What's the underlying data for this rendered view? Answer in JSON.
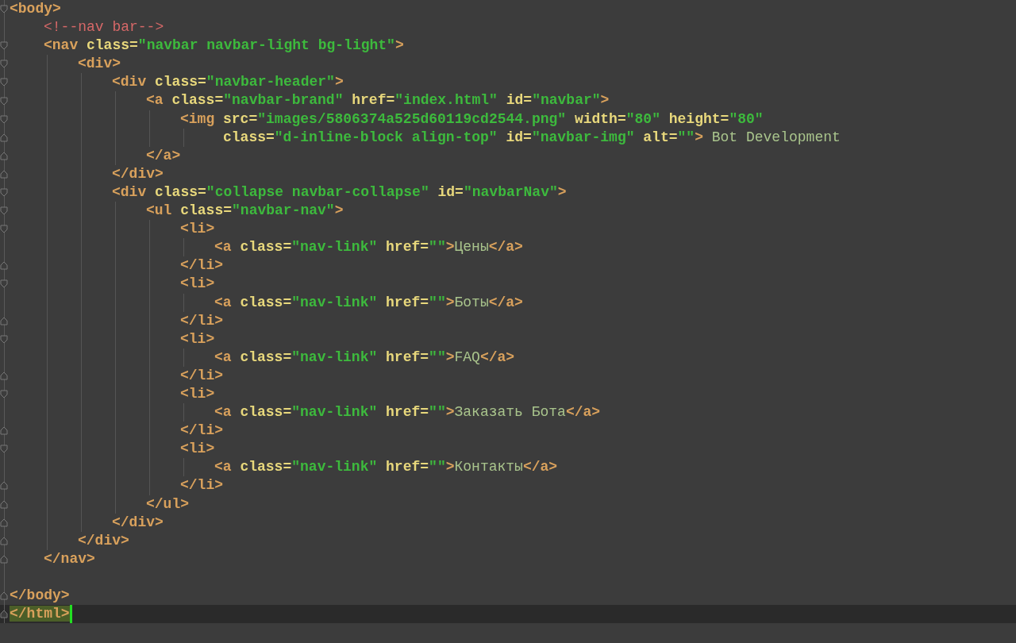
{
  "editor": {
    "lines": [
      {
        "fold_start": true,
        "tokens": [
          {
            "kind": "tag",
            "text": "<body>"
          }
        ],
        "children": [
          {
            "tokens": [
              {
                "kind": "comment",
                "text": "<!--nav bar-->"
              }
            ]
          },
          {
            "fold_start": true,
            "tokens": [
              {
                "kind": "tag",
                "text": "<nav"
              },
              {
                "kind": "attr",
                "text": " class="
              },
              {
                "kind": "str",
                "text": "\"navbar navbar-light bg-light\""
              },
              {
                "kind": "tag",
                "text": ">"
              }
            ],
            "children": [
              {
                "fold_start": true,
                "tokens": [
                  {
                    "kind": "tag",
                    "text": "<div>"
                  }
                ],
                "children": [
                  {
                    "fold_start": true,
                    "tokens": [
                      {
                        "kind": "tag",
                        "text": "<div"
                      },
                      {
                        "kind": "attr",
                        "text": " class="
                      },
                      {
                        "kind": "str",
                        "text": "\"navbar-header\""
                      },
                      {
                        "kind": "tag",
                        "text": ">"
                      }
                    ],
                    "children": [
                      {
                        "fold_start": true,
                        "tokens": [
                          {
                            "kind": "tag",
                            "text": "<a"
                          },
                          {
                            "kind": "attr",
                            "text": " class="
                          },
                          {
                            "kind": "str",
                            "text": "\"navbar-brand\""
                          },
                          {
                            "kind": "attr",
                            "text": " href="
                          },
                          {
                            "kind": "str",
                            "text": "\"index.html\""
                          },
                          {
                            "kind": "attr",
                            "text": " id="
                          },
                          {
                            "kind": "str",
                            "text": "\"navbar\""
                          },
                          {
                            "kind": "tag",
                            "text": ">"
                          }
                        ],
                        "children": [
                          {
                            "fold_start": true,
                            "tokens": [
                              {
                                "kind": "tag",
                                "text": "<img"
                              },
                              {
                                "kind": "attr",
                                "text": " src="
                              },
                              {
                                "kind": "str",
                                "text": "\"images/5806374a525d60119cd2544.png\""
                              },
                              {
                                "kind": "attr",
                                "text": " width="
                              },
                              {
                                "kind": "str",
                                "text": "\"80\""
                              },
                              {
                                "kind": "attr",
                                "text": " height="
                              },
                              {
                                "kind": "str",
                                "text": "\"80\""
                              }
                            ],
                            "wrap": [
                              {
                                "fold_end": true,
                                "tokens": [
                                  {
                                    "kind": "attr",
                                    "text": "class="
                                  },
                                  {
                                    "kind": "str",
                                    "text": "\"d-inline-block align-top\""
                                  },
                                  {
                                    "kind": "attr",
                                    "text": " id="
                                  },
                                  {
                                    "kind": "str",
                                    "text": "\"navbar-img\""
                                  },
                                  {
                                    "kind": "attr",
                                    "text": " alt="
                                  },
                                  {
                                    "kind": "str",
                                    "text": "\"\""
                                  },
                                  {
                                    "kind": "tag",
                                    "text": ">"
                                  },
                                  {
                                    "kind": "text",
                                    "text": " Bot Development"
                                  }
                                ]
                              }
                            ]
                          }
                        ]
                      },
                      {
                        "fold_end": true,
                        "tokens": [
                          {
                            "kind": "tag",
                            "text": "</a>"
                          }
                        ]
                      }
                    ]
                  },
                  {
                    "fold_end": true,
                    "tokens": [
                      {
                        "kind": "tag",
                        "text": "</div>"
                      }
                    ]
                  },
                  {
                    "fold_start": true,
                    "tokens": [
                      {
                        "kind": "tag",
                        "text": "<div"
                      },
                      {
                        "kind": "attr",
                        "text": " class="
                      },
                      {
                        "kind": "str",
                        "text": "\"collapse navbar-collapse\""
                      },
                      {
                        "kind": "attr",
                        "text": " id="
                      },
                      {
                        "kind": "str",
                        "text": "\"navbarNav\""
                      },
                      {
                        "kind": "tag",
                        "text": ">"
                      }
                    ],
                    "children": [
                      {
                        "fold_start": true,
                        "tokens": [
                          {
                            "kind": "tag",
                            "text": "<ul"
                          },
                          {
                            "kind": "attr",
                            "text": " class="
                          },
                          {
                            "kind": "str",
                            "text": "\"navbar-nav\""
                          },
                          {
                            "kind": "tag",
                            "text": ">"
                          }
                        ],
                        "children": [
                          {
                            "fold_start": true,
                            "tokens": [
                              {
                                "kind": "tag",
                                "text": "<li>"
                              }
                            ],
                            "children": [
                              {
                                "tokens": [
                                  {
                                    "kind": "tag",
                                    "text": "<a"
                                  },
                                  {
                                    "kind": "attr",
                                    "text": " class="
                                  },
                                  {
                                    "kind": "str",
                                    "text": "\"nav-link\""
                                  },
                                  {
                                    "kind": "attr",
                                    "text": " href="
                                  },
                                  {
                                    "kind": "str",
                                    "text": "\"\""
                                  },
                                  {
                                    "kind": "tag",
                                    "text": ">"
                                  },
                                  {
                                    "kind": "text",
                                    "text": "Цены"
                                  },
                                  {
                                    "kind": "tag",
                                    "text": "</a>"
                                  }
                                ]
                              }
                            ]
                          },
                          {
                            "fold_end": true,
                            "tokens": [
                              {
                                "kind": "tag",
                                "text": "</li>"
                              }
                            ]
                          },
                          {
                            "fold_start": true,
                            "tokens": [
                              {
                                "kind": "tag",
                                "text": "<li>"
                              }
                            ],
                            "children": [
                              {
                                "tokens": [
                                  {
                                    "kind": "tag",
                                    "text": "<a"
                                  },
                                  {
                                    "kind": "attr",
                                    "text": " class="
                                  },
                                  {
                                    "kind": "str",
                                    "text": "\"nav-link\""
                                  },
                                  {
                                    "kind": "attr",
                                    "text": " href="
                                  },
                                  {
                                    "kind": "str",
                                    "text": "\"\""
                                  },
                                  {
                                    "kind": "tag",
                                    "text": ">"
                                  },
                                  {
                                    "kind": "text",
                                    "text": "Боты"
                                  },
                                  {
                                    "kind": "tag",
                                    "text": "</a>"
                                  }
                                ]
                              }
                            ]
                          },
                          {
                            "fold_end": true,
                            "tokens": [
                              {
                                "kind": "tag",
                                "text": "</li>"
                              }
                            ]
                          },
                          {
                            "fold_start": true,
                            "tokens": [
                              {
                                "kind": "tag",
                                "text": "<li>"
                              }
                            ],
                            "children": [
                              {
                                "tokens": [
                                  {
                                    "kind": "tag",
                                    "text": "<a"
                                  },
                                  {
                                    "kind": "attr",
                                    "text": " class="
                                  },
                                  {
                                    "kind": "str",
                                    "text": "\"nav-link\""
                                  },
                                  {
                                    "kind": "attr",
                                    "text": " href="
                                  },
                                  {
                                    "kind": "str",
                                    "text": "\"\""
                                  },
                                  {
                                    "kind": "tag",
                                    "text": ">"
                                  },
                                  {
                                    "kind": "text",
                                    "text": "FAQ"
                                  },
                                  {
                                    "kind": "tag",
                                    "text": "</a>"
                                  }
                                ]
                              }
                            ]
                          },
                          {
                            "fold_end": true,
                            "tokens": [
                              {
                                "kind": "tag",
                                "text": "</li>"
                              }
                            ]
                          },
                          {
                            "fold_start": true,
                            "tokens": [
                              {
                                "kind": "tag",
                                "text": "<li>"
                              }
                            ],
                            "children": [
                              {
                                "tokens": [
                                  {
                                    "kind": "tag",
                                    "text": "<a"
                                  },
                                  {
                                    "kind": "attr",
                                    "text": " class="
                                  },
                                  {
                                    "kind": "str",
                                    "text": "\"nav-link\""
                                  },
                                  {
                                    "kind": "attr",
                                    "text": " href="
                                  },
                                  {
                                    "kind": "str",
                                    "text": "\"\""
                                  },
                                  {
                                    "kind": "tag",
                                    "text": ">"
                                  },
                                  {
                                    "kind": "text",
                                    "text": "Заказать Бота"
                                  },
                                  {
                                    "kind": "tag",
                                    "text": "</a>"
                                  }
                                ]
                              }
                            ]
                          },
                          {
                            "fold_end": true,
                            "tokens": [
                              {
                                "kind": "tag",
                                "text": "</li>"
                              }
                            ]
                          },
                          {
                            "fold_start": true,
                            "tokens": [
                              {
                                "kind": "tag",
                                "text": "<li>"
                              }
                            ],
                            "children": [
                              {
                                "tokens": [
                                  {
                                    "kind": "tag",
                                    "text": "<a"
                                  },
                                  {
                                    "kind": "attr",
                                    "text": " class="
                                  },
                                  {
                                    "kind": "str",
                                    "text": "\"nav-link\""
                                  },
                                  {
                                    "kind": "attr",
                                    "text": " href="
                                  },
                                  {
                                    "kind": "str",
                                    "text": "\"\""
                                  },
                                  {
                                    "kind": "tag",
                                    "text": ">"
                                  },
                                  {
                                    "kind": "text",
                                    "text": "Контакты"
                                  },
                                  {
                                    "kind": "tag",
                                    "text": "</a>"
                                  }
                                ]
                              }
                            ]
                          },
                          {
                            "fold_end": true,
                            "tokens": [
                              {
                                "kind": "tag",
                                "text": "</li>"
                              }
                            ]
                          }
                        ]
                      },
                      {
                        "fold_end": true,
                        "tokens": [
                          {
                            "kind": "tag",
                            "text": "</ul>"
                          }
                        ]
                      }
                    ]
                  },
                  {
                    "fold_end": true,
                    "tokens": [
                      {
                        "kind": "tag",
                        "text": "</div>"
                      }
                    ]
                  }
                ]
              },
              {
                "fold_end": true,
                "tokens": [
                  {
                    "kind": "tag",
                    "text": "</div>"
                  }
                ]
              }
            ]
          },
          {
            "fold_end": true,
            "tokens": [
              {
                "kind": "tag",
                "text": "</nav>"
              }
            ]
          },
          {
            "kind": "blank"
          }
        ]
      },
      {
        "fold_end": true,
        "tokens": [
          {
            "kind": "tag",
            "text": "</body>"
          }
        ]
      },
      {
        "fold_end": true,
        "current": true,
        "tokens": [
          {
            "kind": "match",
            "text": "</html>"
          }
        ]
      }
    ]
  }
}
